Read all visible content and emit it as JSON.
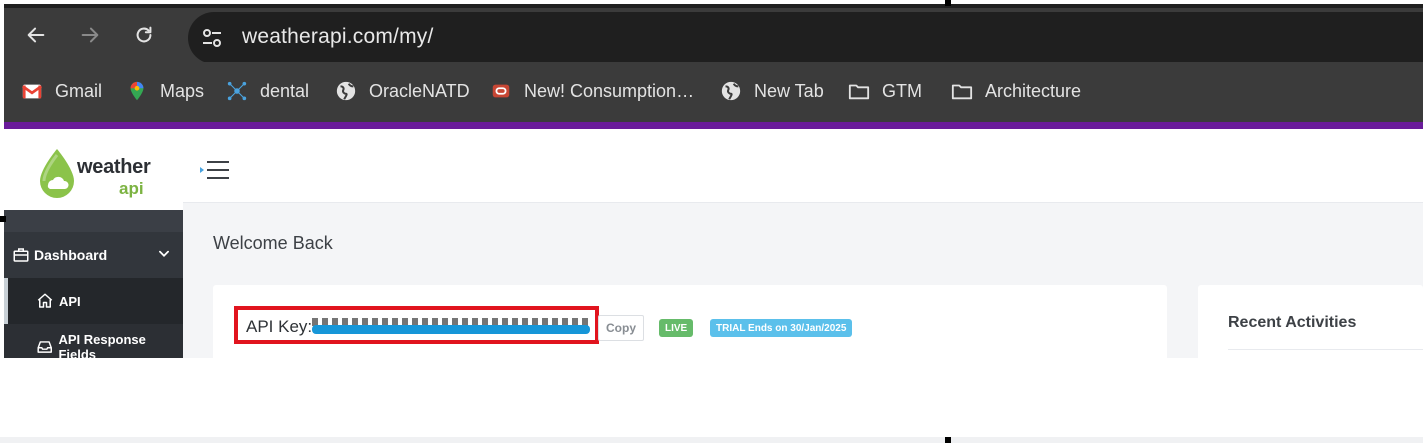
{
  "browser": {
    "url": "weatherapi.com/my/",
    "nav": {
      "back": "back-arrow-icon",
      "forward": "forward-arrow-icon",
      "reload": "reload-icon",
      "site_info": "tune-icon"
    },
    "bookmarks": [
      {
        "label": "Gmail",
        "icon": "gmail-icon"
      },
      {
        "label": "Maps",
        "icon": "maps-pin-icon"
      },
      {
        "label": "dental",
        "icon": "network-icon"
      },
      {
        "label": "OracleNATD",
        "icon": "globe-icon"
      },
      {
        "label": "New! Consumption…",
        "icon": "oracle-icon"
      },
      {
        "label": "New Tab",
        "icon": "globe-icon"
      },
      {
        "label": "GTM",
        "icon": "folder-icon"
      },
      {
        "label": "Architecture",
        "icon": "folder-icon"
      }
    ]
  },
  "colors": {
    "accent_purple": "#6a1b9a",
    "redaction": "#1696d8",
    "highlight_red": "#e1141e",
    "live_green": "#66bb6a",
    "trial_blue": "#5bc0eb"
  },
  "logo": {
    "line1": "weather",
    "line2": "api"
  },
  "sidebar": {
    "dashboard": {
      "label": "Dashboard",
      "icon": "briefcase-icon"
    },
    "items": [
      {
        "label": "API",
        "icon": "home-icon",
        "active": true
      },
      {
        "label": "API Response Fields",
        "icon": "inbox-icon",
        "active": false
      }
    ]
  },
  "main": {
    "welcome": "Welcome Back",
    "api_key_label": "API Key:",
    "copy_label": "Copy",
    "live_badge": "LIVE",
    "trial_badge": "TRIAL Ends on 30/Jan/2025",
    "recent_title": "Recent Activities"
  }
}
